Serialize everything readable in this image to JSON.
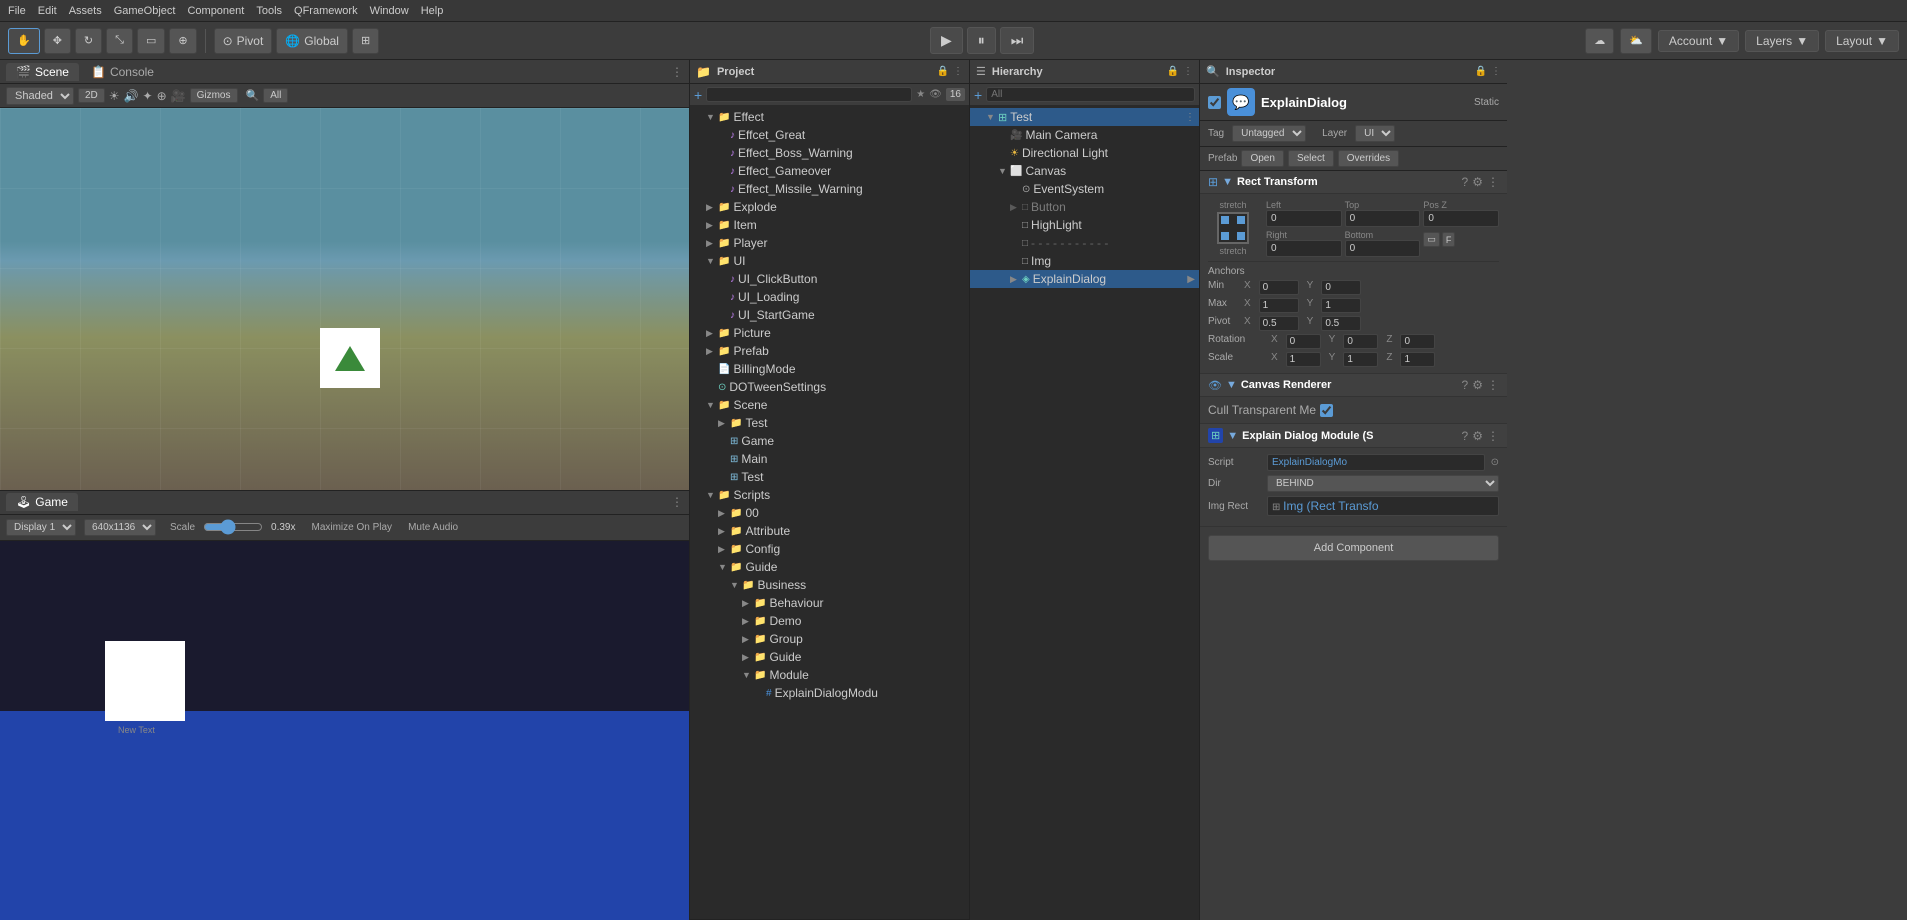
{
  "menubar": {
    "items": [
      "File",
      "Edit",
      "Assets",
      "GameObject",
      "Component",
      "Tools",
      "QFramework",
      "Window",
      "Help"
    ]
  },
  "toolbar": {
    "tools": [
      "hand",
      "move",
      "rotate",
      "scale",
      "rect",
      "transform"
    ],
    "pivot_label": "Pivot",
    "global_label": "Global",
    "play_btn": "▶",
    "pause_btn": "⏸",
    "step_btn": "⏭",
    "account_label": "Account",
    "layers_label": "Layers",
    "layout_label": "Layout"
  },
  "scene_panel": {
    "tab_scene": "Scene",
    "tab_console": "Console",
    "shading": "Shaded",
    "mode_2d": "2D",
    "gizmos": "Gizmos",
    "all_label": "All"
  },
  "game_panel": {
    "tab_game": "Game",
    "display": "Display 1",
    "resolution": "640x1136",
    "scale_label": "Scale",
    "scale_value": "0.39x",
    "maximize": "Maximize On Play",
    "mute": "Mute Audio"
  },
  "project_panel": {
    "title": "Project",
    "search_placeholder": "",
    "count": "16",
    "tree": [
      {
        "level": 1,
        "type": "folder",
        "label": "Effect",
        "expanded": true
      },
      {
        "level": 2,
        "type": "music",
        "label": "Effcet_Great"
      },
      {
        "level": 2,
        "type": "music",
        "label": "Effect_Boss_Warning"
      },
      {
        "level": 2,
        "type": "music",
        "label": "Effect_Gameover"
      },
      {
        "level": 2,
        "type": "music",
        "label": "Effect_Missile_Warning"
      },
      {
        "level": 1,
        "type": "folder",
        "label": "Explode"
      },
      {
        "level": 1,
        "type": "folder",
        "label": "Item"
      },
      {
        "level": 1,
        "type": "folder",
        "label": "Player"
      },
      {
        "level": 1,
        "type": "folder",
        "label": "UI",
        "expanded": true
      },
      {
        "level": 2,
        "type": "music",
        "label": "UI_ClickButton"
      },
      {
        "level": 2,
        "type": "music",
        "label": "UI_Loading"
      },
      {
        "level": 2,
        "type": "music",
        "label": "UI_StartGame"
      },
      {
        "level": 1,
        "type": "folder",
        "label": "Picture"
      },
      {
        "level": 1,
        "type": "folder",
        "label": "Prefab"
      },
      {
        "level": 1,
        "type": "asset",
        "label": "BillingMode"
      },
      {
        "level": 1,
        "type": "asset",
        "label": "DOTweenSettings"
      },
      {
        "level": 1,
        "type": "folder",
        "label": "Scene",
        "expanded": true
      },
      {
        "level": 2,
        "type": "folder",
        "label": "Test"
      },
      {
        "level": 2,
        "type": "scene",
        "label": "Game"
      },
      {
        "level": 2,
        "type": "scene",
        "label": "Main"
      },
      {
        "level": 2,
        "type": "scene",
        "label": "Test"
      },
      {
        "level": 1,
        "type": "folder",
        "label": "Scripts",
        "expanded": true
      },
      {
        "level": 2,
        "type": "folder",
        "label": "00"
      },
      {
        "level": 2,
        "type": "folder",
        "label": "Attribute"
      },
      {
        "level": 2,
        "type": "folder",
        "label": "Config"
      },
      {
        "level": 2,
        "type": "folder",
        "label": "Guide",
        "expanded": true
      },
      {
        "level": 3,
        "type": "folder",
        "label": "Business",
        "expanded": true
      },
      {
        "level": 4,
        "type": "folder",
        "label": "Behaviour"
      },
      {
        "level": 4,
        "type": "folder",
        "label": "Demo"
      },
      {
        "level": 4,
        "type": "folder",
        "label": "Group"
      },
      {
        "level": 4,
        "type": "folder",
        "label": "Guide"
      },
      {
        "level": 4,
        "type": "folder",
        "label": "Module",
        "expanded": true
      },
      {
        "level": 5,
        "type": "script",
        "label": "ExplainDialogModu"
      }
    ]
  },
  "hierarchy_panel": {
    "title": "Hierarchy",
    "search_placeholder": "All",
    "tree": [
      {
        "level": 0,
        "type": "folder",
        "label": "Test",
        "expanded": true,
        "has_menu": true
      },
      {
        "level": 1,
        "type": "camera",
        "label": "Main Camera"
      },
      {
        "level": 1,
        "type": "light",
        "label": "Directional Light"
      },
      {
        "level": 1,
        "type": "canvas",
        "label": "Canvas",
        "expanded": true
      },
      {
        "level": 2,
        "type": "eventsystem",
        "label": "EventSystem"
      },
      {
        "level": 2,
        "type": "button",
        "label": "Button",
        "disabled": true
      },
      {
        "level": 2,
        "type": "highlight",
        "label": "HighLight"
      },
      {
        "level": 2,
        "type": "dashed",
        "label": "- - - - - - - - - - -"
      },
      {
        "level": 2,
        "type": "img",
        "label": "Img"
      },
      {
        "level": 2,
        "type": "explain",
        "label": "ExplainDialog",
        "selected": true,
        "has_arrow": true
      }
    ]
  },
  "inspector": {
    "title": "Inspector",
    "obj_name": "ExplainDialog",
    "static_label": "Static",
    "tag_label": "Tag",
    "tag_value": "Untagged",
    "layer_label": "Layer",
    "layer_value": "UI",
    "prefab_label": "Prefab",
    "open_label": "Open",
    "select_label": "Select",
    "overrides_label": "Overrides",
    "rect_transform": {
      "title": "Rect Transform",
      "stretch_label": "stretch",
      "left_label": "Left",
      "top_label": "Top",
      "posz_label": "Pos Z",
      "left_val": "0",
      "top_val": "0",
      "posz_val": "0",
      "right_label": "Right",
      "bottom_label": "Bottom",
      "right_val": "0",
      "bottom_val": "0"
    },
    "anchors": {
      "title": "Anchors",
      "min_label": "Min",
      "min_x": "0",
      "min_y": "0",
      "max_label": "Max",
      "max_x": "1",
      "max_y": "1",
      "pivot_label": "Pivot",
      "pivot_x": "0.5",
      "pivot_y": "0.5",
      "rotation_label": "Rotation",
      "rot_x": "0",
      "rot_y": "0",
      "rot_z": "0",
      "scale_label": "Scale",
      "scale_x": "1",
      "scale_y": "1",
      "scale_z": "1"
    },
    "canvas_renderer": {
      "title": "Canvas Renderer",
      "cull_label": "Cull Transparent Me",
      "cull_checked": true
    },
    "explain_module": {
      "title": "Explain Dialog Module (S",
      "script_label": "Script",
      "script_value": "ExplainDialogMo",
      "dir_label": "Dir",
      "dir_value": "BEHIND",
      "imgrect_label": "Img Rect",
      "imgrect_value": "Img (Rect Transfo"
    },
    "add_component_label": "Add Component"
  }
}
